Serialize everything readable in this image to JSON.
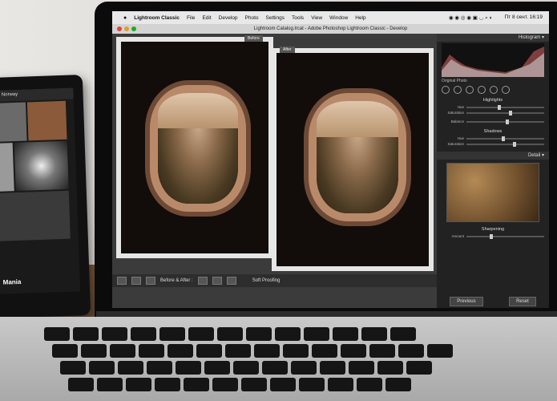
{
  "menubar": {
    "app": "Lightroom Classic",
    "items": [
      "File",
      "Edit",
      "Develop",
      "Photo",
      "Settings",
      "Tools",
      "View",
      "Window",
      "Help"
    ],
    "right_time": "Пт 8 сент. 16:19"
  },
  "titlebar": {
    "title": "Lightroom Catalog.lrcat - Adobe Photoshop Lightroom Classic - Develop"
  },
  "view_tabs": {
    "before": "Before",
    "after": "After"
  },
  "toolbar": {
    "mode": "Before & After :",
    "soft_proofing": "Soft Proofing"
  },
  "panel": {
    "histogram": "Histogram",
    "original_photo": "Original Photo",
    "highlights": "Highlights",
    "hue": "Hue",
    "saturation": "Saturation",
    "balance": "Balance",
    "shadows": "Shadows",
    "detail": "Detail",
    "sharpening": "Sharpening",
    "amount": "Amount",
    "previous": "Previous",
    "reset": "Reset"
  },
  "tablet": {
    "header": "in Norway",
    "caption": "Mania"
  },
  "colors": {
    "menubar_bg": "#e8e8e8",
    "panel_bg": "#222222",
    "workarea_bg": "#3b3b3b"
  }
}
